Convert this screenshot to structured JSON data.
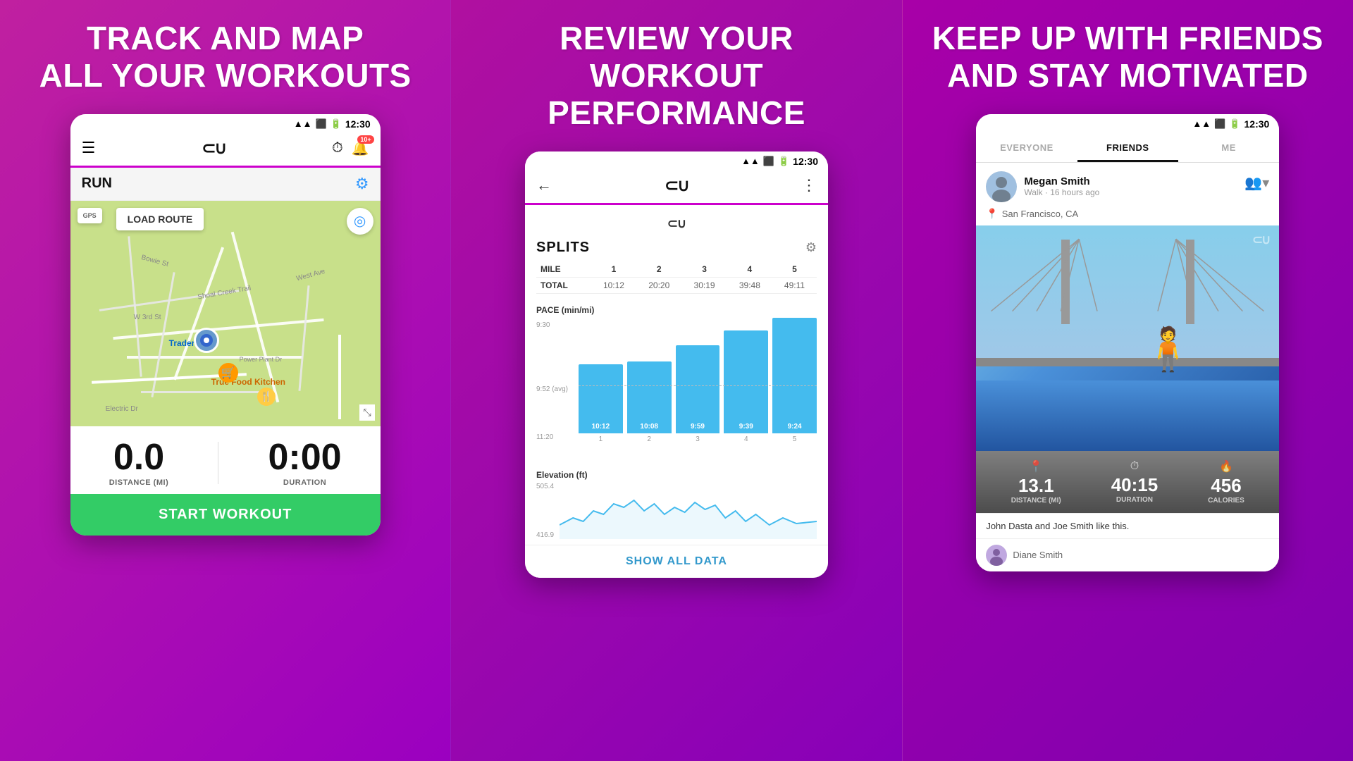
{
  "panel1": {
    "heading_line1": "TRACK AND MAP",
    "heading_line2": "ALL YOUR WORKOUTS",
    "status_time": "12:30",
    "app_bar": {
      "menu_label": "☰",
      "notification_badge": "10+",
      "run_label": "RUN"
    },
    "map": {
      "gps_label": "GPS",
      "load_route_label": "LOAD ROUTE",
      "place1": "Trader Joe's",
      "place2": "True Food Kitchen",
      "street1": "Shoal Creek Trail",
      "street2": "W 3rd St",
      "street3": "Bowie St",
      "street4": "West Ave",
      "street5": "Electric Dr",
      "street6": "Power Plant Dr"
    },
    "distance_value": "0.0",
    "distance_label": "DISTANCE (MI)",
    "duration_value": "0:00",
    "duration_label": "DURATION",
    "start_btn_label": "START WORKOUT"
  },
  "panel2": {
    "heading_line1": "REVIEW YOUR",
    "heading_line2": "WORKOUT PERFORMANCE",
    "status_time": "12:30",
    "splits": {
      "title": "SPLITS",
      "columns": [
        "MILE",
        "1",
        "2",
        "3",
        "4",
        "5"
      ],
      "rows": [
        {
          "label": "TOTAL",
          "values": [
            "10:12",
            "20:20",
            "30:19",
            "39:48",
            "49:11"
          ]
        }
      ]
    },
    "pace_label": "PACE (min/mi)",
    "y_axis": {
      "top": "9:30",
      "mid": "9:52 (avg)",
      "bottom": "11:20"
    },
    "bars": [
      {
        "mile": "1",
        "value": "10:12",
        "height_pct": 55
      },
      {
        "mile": "2",
        "value": "10:08",
        "height_pct": 57
      },
      {
        "mile": "3",
        "value": "9:59",
        "height_pct": 70
      },
      {
        "mile": "4",
        "value": "9:39",
        "height_pct": 82
      },
      {
        "mile": "5",
        "value": "9:24",
        "height_pct": 95
      }
    ],
    "elevation_label": "Elevation (ft)",
    "elevation_top": "505.4",
    "elevation_bottom": "416.9",
    "show_all_label": "SHOW ALL DATA"
  },
  "panel3": {
    "heading_line1": "KEEP UP WITH FRIENDS",
    "heading_line2": "AND STAY MOTIVATED",
    "status_time": "12:30",
    "tabs": [
      {
        "label": "EVERYONE",
        "active": false
      },
      {
        "label": "FRIENDS",
        "active": true
      },
      {
        "label": "ME",
        "active": false
      }
    ],
    "activity": {
      "user_name": "Megan Smith",
      "activity_type": "Walk",
      "time_ago": "16 hours ago",
      "location": "San Francisco, CA",
      "distance_value": "13.1",
      "distance_label": "DISTANCE (MI)",
      "duration_value": "40:15",
      "duration_label": "DURATION",
      "calories_value": "456",
      "calories_label": "CALORIES",
      "likes_text": "John Dasta and Joe Smith like this.",
      "commenter_name": "Diane Smith"
    }
  }
}
